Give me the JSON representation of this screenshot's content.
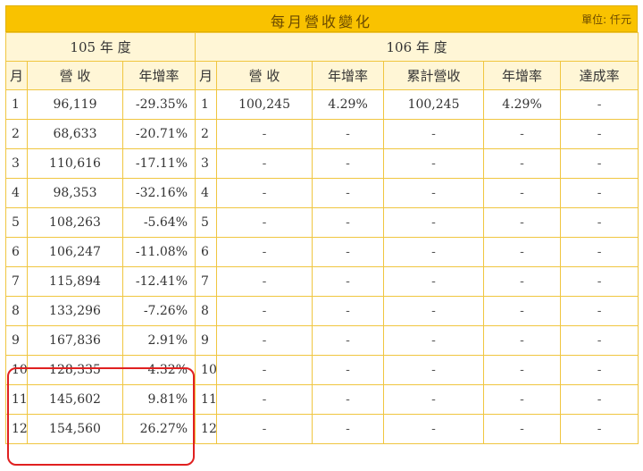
{
  "header": {
    "title": "每月營收變化",
    "unit": "單位: 仟元"
  },
  "year105": {
    "label": "105 年 度",
    "columns": [
      "月",
      "營 收",
      "年增率"
    ],
    "rows": [
      {
        "month": "1",
        "revenue": "96,119",
        "yoy": "-29.35%"
      },
      {
        "month": "2",
        "revenue": "68,633",
        "yoy": "-20.71%"
      },
      {
        "month": "3",
        "revenue": "110,616",
        "yoy": "-17.11%"
      },
      {
        "month": "4",
        "revenue": "98,353",
        "yoy": "-32.16%"
      },
      {
        "month": "5",
        "revenue": "108,263",
        "yoy": "-5.64%"
      },
      {
        "month": "6",
        "revenue": "106,247",
        "yoy": "-11.08%"
      },
      {
        "month": "7",
        "revenue": "115,894",
        "yoy": "-12.41%"
      },
      {
        "month": "8",
        "revenue": "133,296",
        "yoy": "-7.26%"
      },
      {
        "month": "9",
        "revenue": "167,836",
        "yoy": "2.91%"
      },
      {
        "month": "10",
        "revenue": "128,335",
        "yoy": "4.32%"
      },
      {
        "month": "11",
        "revenue": "145,602",
        "yoy": "9.81%"
      },
      {
        "month": "12",
        "revenue": "154,560",
        "yoy": "26.27%"
      }
    ]
  },
  "year106": {
    "label": "106 年 度",
    "columns": [
      "月",
      "營 收",
      "年增率",
      "累計營收",
      "年增率",
      "達成率"
    ],
    "rows": [
      {
        "month": "1",
        "revenue": "100,245",
        "yoy": "4.29%",
        "cum": "100,245",
        "cum_yoy": "4.29%",
        "rate": "-"
      },
      {
        "month": "2",
        "revenue": "-",
        "yoy": "-",
        "cum": "-",
        "cum_yoy": "-",
        "rate": "-"
      },
      {
        "month": "3",
        "revenue": "-",
        "yoy": "-",
        "cum": "-",
        "cum_yoy": "-",
        "rate": "-"
      },
      {
        "month": "4",
        "revenue": "-",
        "yoy": "-",
        "cum": "-",
        "cum_yoy": "-",
        "rate": "-"
      },
      {
        "month": "5",
        "revenue": "-",
        "yoy": "-",
        "cum": "-",
        "cum_yoy": "-",
        "rate": "-"
      },
      {
        "month": "6",
        "revenue": "-",
        "yoy": "-",
        "cum": "-",
        "cum_yoy": "-",
        "rate": "-"
      },
      {
        "month": "7",
        "revenue": "-",
        "yoy": "-",
        "cum": "-",
        "cum_yoy": "-",
        "rate": "-"
      },
      {
        "month": "8",
        "revenue": "-",
        "yoy": "-",
        "cum": "-",
        "cum_yoy": "-",
        "rate": "-"
      },
      {
        "month": "9",
        "revenue": "-",
        "yoy": "-",
        "cum": "-",
        "cum_yoy": "-",
        "rate": "-"
      },
      {
        "month": "10",
        "revenue": "-",
        "yoy": "-",
        "cum": "-",
        "cum_yoy": "-",
        "rate": "-"
      },
      {
        "month": "11",
        "revenue": "-",
        "yoy": "-",
        "cum": "-",
        "cum_yoy": "-",
        "rate": "-"
      },
      {
        "month": "12",
        "revenue": "-",
        "yoy": "-",
        "cum": "-",
        "cum_yoy": "-",
        "rate": "-"
      }
    ]
  },
  "colors": {
    "title_bg": "#f9c200",
    "header_bg": "#fff6d6",
    "border": "#f0c640",
    "highlight": "#e02020"
  }
}
